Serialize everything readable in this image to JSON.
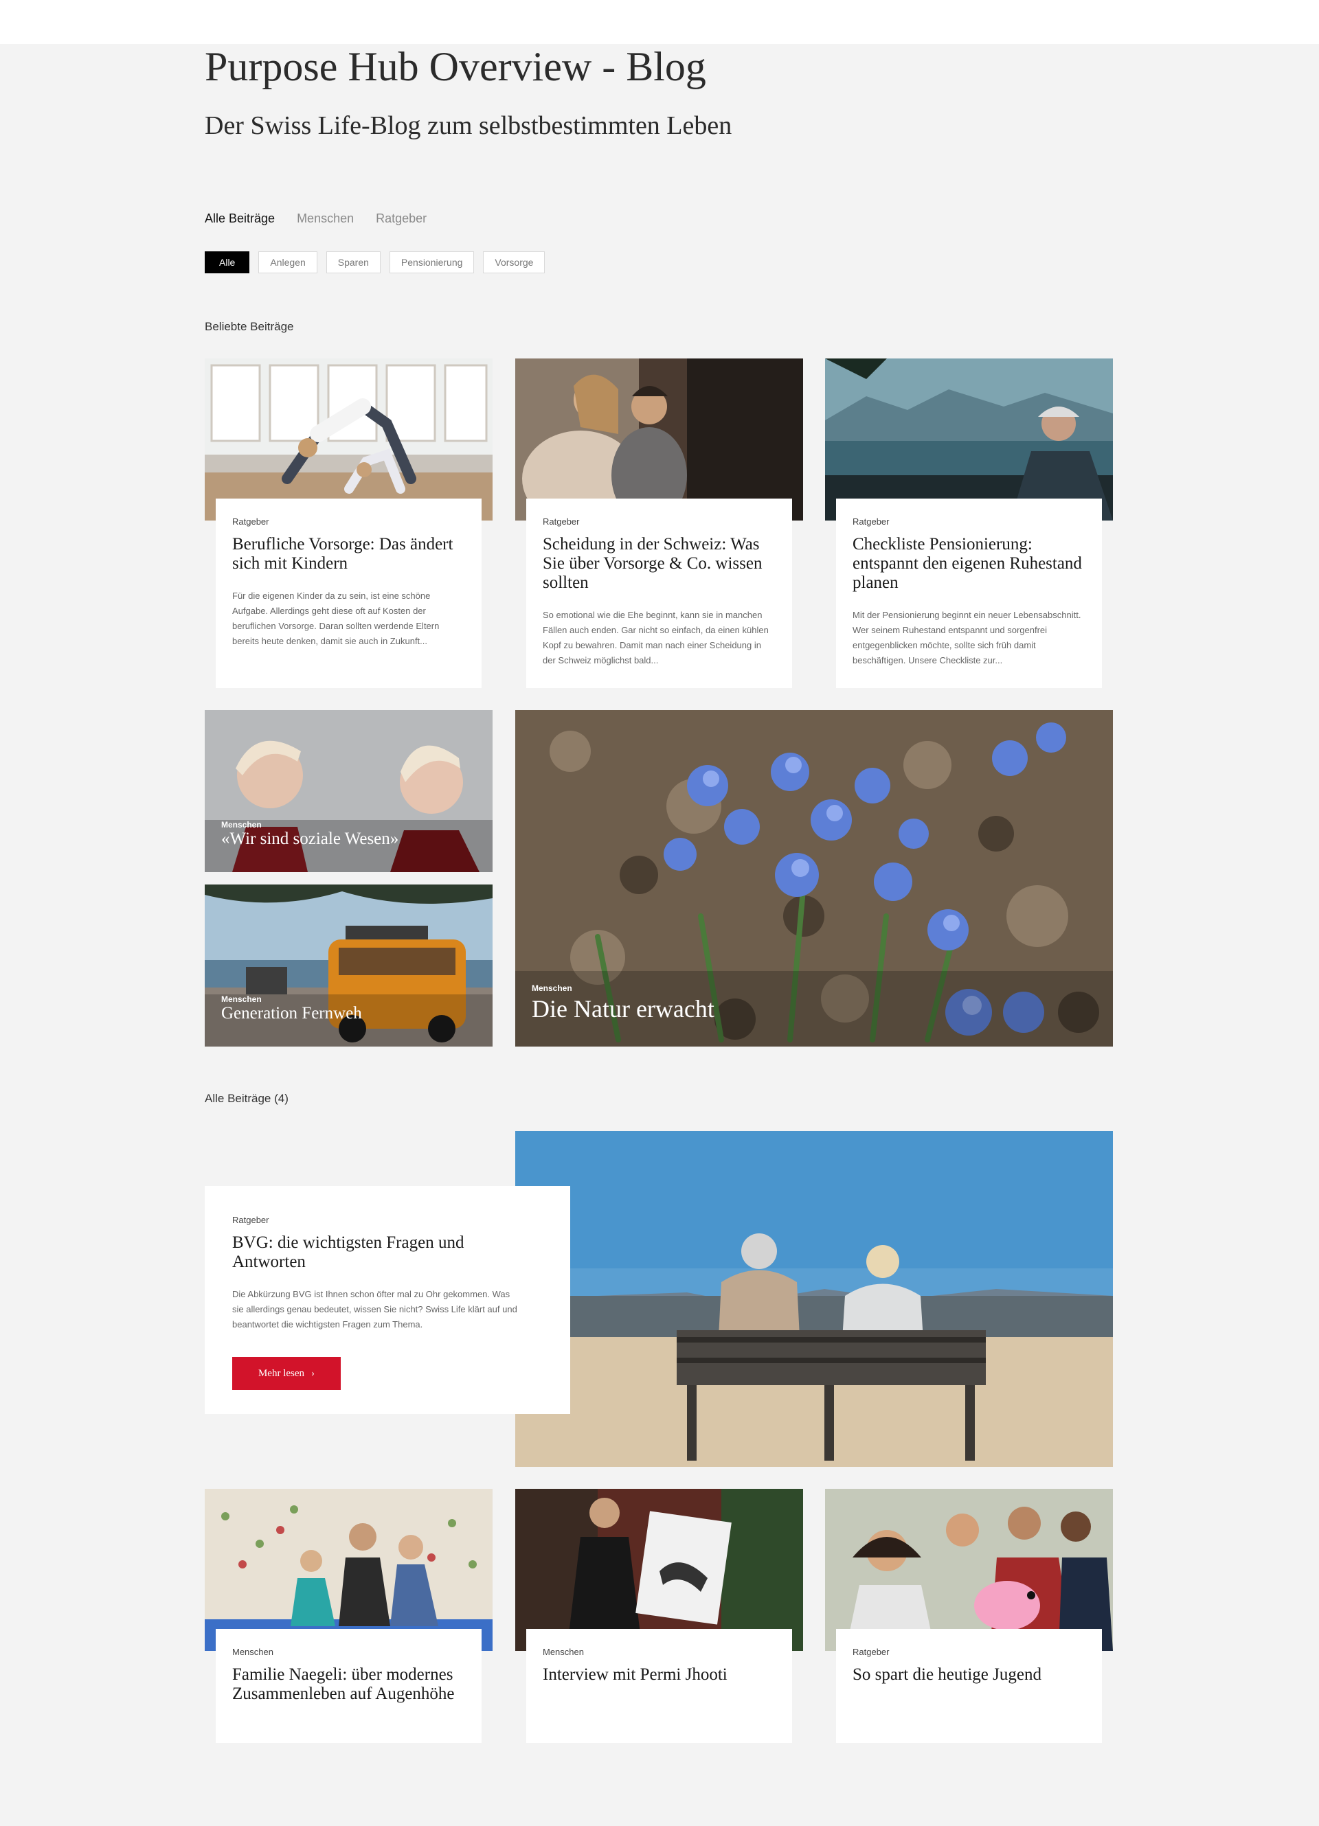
{
  "page": {
    "title": "Purpose Hub Overview - Blog",
    "subtitle": "Der Swiss Life-Blog zum selbstbestimmten Leben"
  },
  "tabs": [
    {
      "label": "Alle Beiträge",
      "active": true
    },
    {
      "label": "Menschen",
      "active": false
    },
    {
      "label": "Ratgeber",
      "active": false
    }
  ],
  "filters": [
    {
      "label": "Alle",
      "active": true
    },
    {
      "label": "Anlegen",
      "active": false
    },
    {
      "label": "Sparen",
      "active": false
    },
    {
      "label": "Pensionierung",
      "active": false
    },
    {
      "label": "Vorsorge",
      "active": false
    }
  ],
  "popular": {
    "label": "Beliebte Beiträge",
    "cards": [
      {
        "category": "Ratgeber",
        "title": "Berufliche Vorsorge: Das ändert sich mit Kindern",
        "excerpt": "Für die eigenen Kinder da zu sein, ist eine schöne Aufgabe. Allerdings geht diese oft auf Kosten der beruflichen Vorsorge. Daran sollten werdende Eltern bereits heute denken, damit sie auch in Zukunft..."
      },
      {
        "category": "Ratgeber",
        "title": "Scheidung in der Schweiz: Was Sie über Vorsorge & Co. wissen sollten",
        "excerpt": "So emotional wie die Ehe beginnt, kann sie in manchen Fällen auch enden. Gar nicht so einfach, da einen kühlen Kopf zu bewahren. Damit man nach einer Scheidung in der Schweiz möglichst bald..."
      },
      {
        "category": "Ratgeber",
        "title": "Checkliste Pensionierung: entspannt den eigenen Ruhestand planen",
        "excerpt": "Mit der Pensionierung beginnt ein neuer Lebensabschnitt. Wer seinem Ruhestand entspannt und sorgenfrei entgegenblicken möchte, sollte sich früh damit beschäftigen. Unsere Checkliste zur..."
      }
    ],
    "tiles": [
      {
        "category": "Menschen",
        "title": "«Wir sind soziale Wesen»"
      },
      {
        "category": "Menschen",
        "title": "Generation Fernweh"
      },
      {
        "category": "Menschen",
        "title": "Die Natur erwacht"
      }
    ]
  },
  "all_posts": {
    "label": "Alle Beiträge (4)",
    "feature": {
      "category": "Ratgeber",
      "title": "BVG: die wichtigsten Fragen und Antworten",
      "excerpt": "Die Abkürzung BVG ist Ihnen schon öfter mal zu Ohr gekommen. Was sie allerdings genau bedeutet, wissen Sie nicht? Swiss Life klärt auf und beantwortet die wichtigsten Fragen zum Thema.",
      "button": "Mehr lesen"
    },
    "cards": [
      {
        "category": "Menschen",
        "title": "Familie Naegeli: über modernes Zusammenleben auf Augenhöhe"
      },
      {
        "category": "Menschen",
        "title": "Interview mit Permi Jhooti"
      },
      {
        "category": "Ratgeber",
        "title": "So spart die heutige Jugend"
      }
    ]
  },
  "colors": {
    "accent_red": "#d2132a",
    "background": "#f3f3f3"
  }
}
